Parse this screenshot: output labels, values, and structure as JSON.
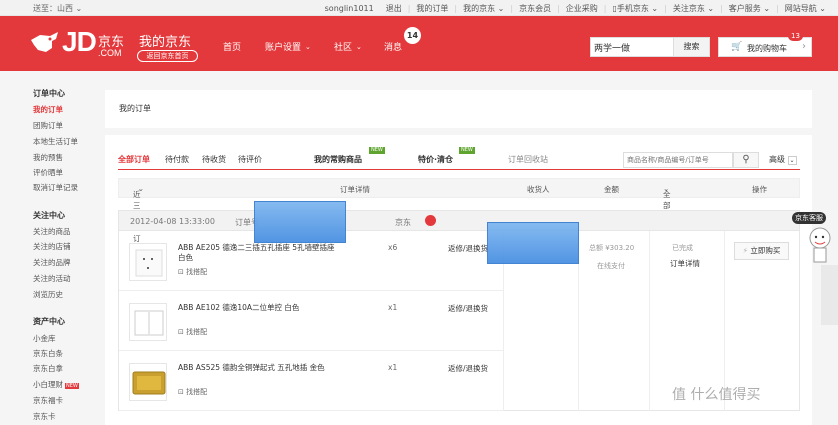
{
  "topbar": {
    "location": "送至：山西",
    "links": [
      "songlin1011",
      "退出",
      "我的订单",
      "我的京东",
      "京东会员",
      "企业采购",
      "手机京东",
      "关注京东",
      "客户服务",
      "网站导航"
    ]
  },
  "header": {
    "logo_text": "JD",
    "logo_cn": "京东",
    "logo_com": ".COM",
    "my_jd": "我的京东",
    "back_home": "返回京东首页",
    "nav": [
      "首页",
      "账户设置",
      "社区",
      "消息"
    ],
    "message_count": "14",
    "search_value": "两学一做",
    "search_button": "搜索",
    "cart_label": "我的购物车",
    "cart_count": "13"
  },
  "sidebar": {
    "sections": [
      {
        "title": "订单中心",
        "items": [
          "我的订单",
          "团购订单",
          "本地生活订单",
          "我的预售",
          "评价晒单",
          "取消订单记录"
        ]
      },
      {
        "title": "关注中心",
        "items": [
          "关注的商品",
          "关注的店铺",
          "关注的品牌",
          "关注的活动",
          "浏览历史"
        ]
      },
      {
        "title": "资产中心",
        "items": [
          "小金库",
          "京东白条",
          "京东白拿",
          "小白理财",
          "京东福卡",
          "京东卡"
        ]
      }
    ],
    "hot_tag": "NEW"
  },
  "main": {
    "breadcrumb": "我的订单",
    "tabs": [
      "全部订单",
      "待付款",
      "待收货",
      "待评价"
    ],
    "tab_common": "我的常购商品",
    "tab_sale": "特价·清仓",
    "tab_recycle": "订单回收站",
    "new_tag": "NEW",
    "search_placeholder": "商品名称/商品编号/订单号",
    "advanced": "高级",
    "columns": {
      "period": "近三个月订单",
      "details": "订单详情",
      "receiver": "收货人",
      "amount": "金额",
      "status": "全部状态",
      "action": "操作"
    },
    "order": {
      "date": "2012-04-08 13:33:00",
      "number_label": "订单号",
      "shop": "京东",
      "total": "总额 ¥303.20",
      "pay_method": "在线支付",
      "status": "已完成",
      "detail_link": "订单详情",
      "buy_again": "立即购买",
      "items": [
        {
          "name": "ABB AE205 德逸二三插五孔插座 5孔墙壁插座 白色",
          "qty": "x6",
          "aftersale": "返修/退换货",
          "find_similar": "找搭配"
        },
        {
          "name": "ABB AE102 德逸10A二位单控 白色",
          "qty": "x1",
          "aftersale": "返修/退换货",
          "find_similar": "找搭配"
        },
        {
          "name": "ABB AS525 德韵全铜弹起式 五孔地插 金色",
          "qty": "x1",
          "aftersale": "返修/退换货",
          "find_similar": "找搭配"
        }
      ]
    }
  },
  "float": {
    "kefu": "京东客服",
    "watermark": "值 什么值得买"
  }
}
